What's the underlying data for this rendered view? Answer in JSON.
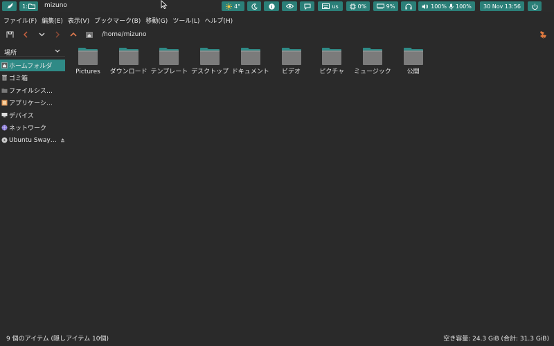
{
  "topbar": {
    "workspace_label": "1:",
    "window_title": "mizuno",
    "weather": "4°",
    "keyboard_layout": "us",
    "cpu": "0%",
    "memory": "9%",
    "volume": "100%",
    "mic": "100%",
    "datetime": "30 Nov 13:56",
    "accent_color": "#2b7f78"
  },
  "menubar": {
    "file": "ファイル(F)",
    "edit": "編集(E)",
    "view": "表示(V)",
    "bookmarks": "ブックマーク(B)",
    "go": "移動(G)",
    "tools": "ツール(L)",
    "help": "ヘルプ(H)"
  },
  "toolbar": {
    "path": "/home/mizuno"
  },
  "sidebar": {
    "header": "場所",
    "items": [
      {
        "label": "ホームフォルダ",
        "icon": "home-icon",
        "selected": true
      },
      {
        "label": "ゴミ箱",
        "icon": "trash-icon"
      },
      {
        "label": "ファイルシス…",
        "icon": "drive-icon"
      },
      {
        "label": "アプリケーシ…",
        "icon": "applications-icon"
      },
      {
        "label": "デバイス",
        "icon": "devices-icon"
      },
      {
        "label": "ネットワーク",
        "icon": "network-icon"
      },
      {
        "label": "Ubuntu Sway …",
        "icon": "disc-icon"
      }
    ]
  },
  "files": [
    {
      "name": "Pictures"
    },
    {
      "name": "ダウンロード"
    },
    {
      "name": "テンプレート"
    },
    {
      "name": "デスクトップ"
    },
    {
      "name": "ドキュメント"
    },
    {
      "name": "ビデオ"
    },
    {
      "name": "ピクチャ"
    },
    {
      "name": "ミュージック"
    },
    {
      "name": "公開"
    }
  ],
  "statusbar": {
    "items": "9 個のアイテム (隠しアイテム 10個)",
    "free_space": "空き容量: 24.3 GiB (合計: 31.3 GiB)"
  }
}
